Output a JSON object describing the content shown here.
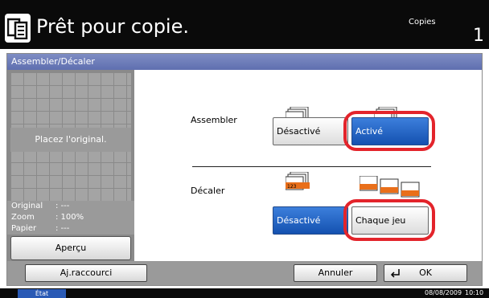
{
  "header": {
    "title": "Prêt pour copie.",
    "copies_label": "Copies",
    "copies_count": "1",
    "icon": "copy-icon"
  },
  "panel": {
    "title": "Assembler/Décaler"
  },
  "preview": {
    "message": "Placez l'original.",
    "rows": [
      {
        "label": "Original",
        "value": ": ---"
      },
      {
        "label": "Zoom",
        "value": ": 100%"
      },
      {
        "label": "Papier",
        "value": ": ---"
      }
    ],
    "apercu_label": "Aperçu"
  },
  "assembler": {
    "label": "Assembler",
    "icon_off_text": "112233",
    "icon_on_text": "123123",
    "off_label": "Désactivé",
    "on_label": "Activé",
    "selected": "on"
  },
  "decaler": {
    "label": "Décaler",
    "off_label": "Désactivé",
    "on_label": "Chaque jeu",
    "selected": "off",
    "icon_text": "123"
  },
  "bottom": {
    "shortcut_label": "Aj.raccourci",
    "cancel_label": "Annuler",
    "ok_label": "OK"
  },
  "status": {
    "state_label": "État",
    "date": "08/08/2009",
    "time": "10:10"
  },
  "colors": {
    "accent": "#1451b0",
    "highlight": "#e3242b",
    "panel_title": "#6676b8"
  }
}
